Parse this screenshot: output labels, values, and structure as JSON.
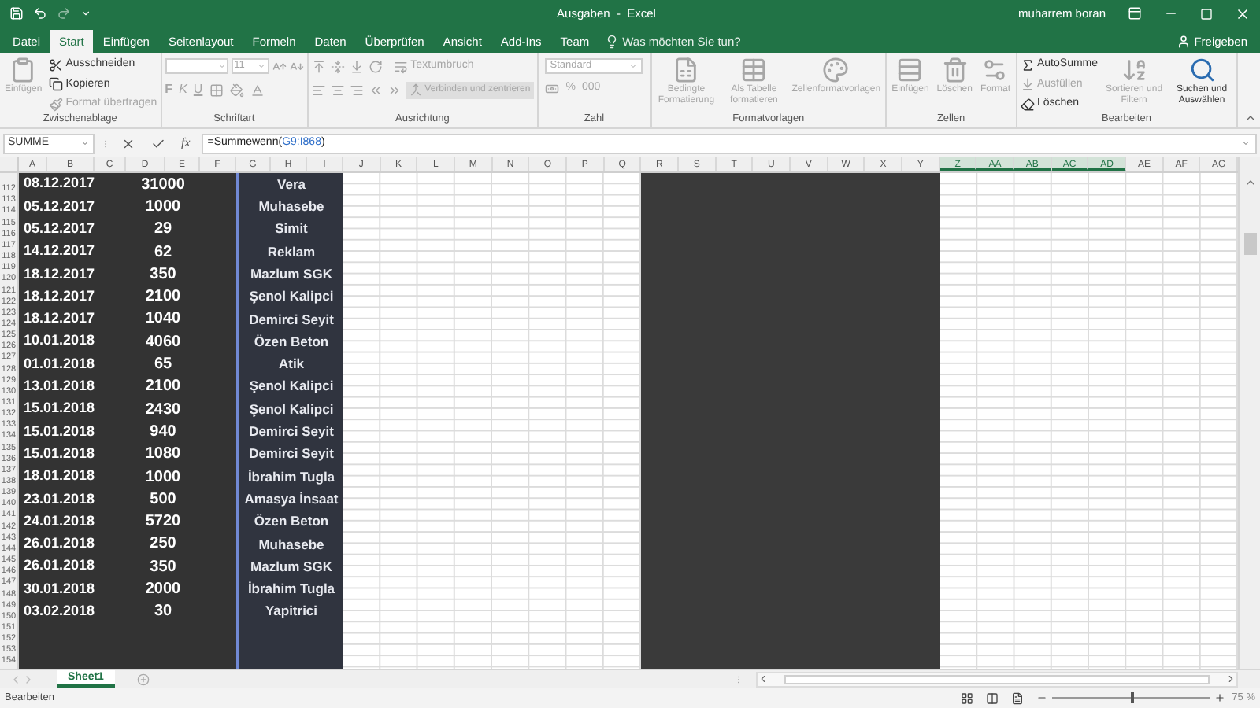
{
  "title_bar": {
    "title": "Ausgaben  -  Excel",
    "user": "muharrem boran"
  },
  "tabs": [
    {
      "label": "Datei",
      "selected": false
    },
    {
      "label": "Start",
      "selected": true
    },
    {
      "label": "Einfügen",
      "selected": false
    },
    {
      "label": "Seitenlayout",
      "selected": false
    },
    {
      "label": "Formeln",
      "selected": false
    },
    {
      "label": "Daten",
      "selected": false
    },
    {
      "label": "Überprüfen",
      "selected": false
    },
    {
      "label": "Ansicht",
      "selected": false
    },
    {
      "label": "Add-Ins",
      "selected": false
    },
    {
      "label": "Team",
      "selected": false
    }
  ],
  "tell_me": "Was möchten Sie tun?",
  "share": "Freigeben",
  "ribbon": [
    {
      "kind": "items",
      "label": "Zwischenablage",
      "items": [
        {
          "label": "Einfügen",
          "kind": "large",
          "disabled": true
        },
        {
          "label": "Ausschneiden",
          "kind": "small",
          "disabled": false
        },
        {
          "label": "Kopieren",
          "kind": "small",
          "disabled": false
        },
        {
          "label": "Format übertragen",
          "kind": "small",
          "disabled": true
        }
      ]
    },
    {
      "kind": "font",
      "label": "Schriftart",
      "font_size": "11",
      "style_buttons": [
        "F",
        "K",
        "U"
      ],
      "disabled": true
    },
    {
      "kind": "alignment",
      "label": "Ausrichtung",
      "wrap": "Textumbruch",
      "merge": "Verbinden und zentrieren",
      "disabled": true
    },
    {
      "kind": "number",
      "label": "Zahl",
      "format": "Standard",
      "number_buttons": [
        "%",
        "000"
      ],
      "disabled": true
    },
    {
      "kind": "items",
      "label": "Formatvorlagen",
      "items": [
        {
          "label": "Bedingte Formatierung",
          "kind": "large",
          "disabled": true
        },
        {
          "label": "Als Tabelle formatieren",
          "kind": "large",
          "disabled": true
        },
        {
          "label": "Zellenformatvorlagen",
          "kind": "large",
          "disabled": true
        }
      ]
    },
    {
      "kind": "items",
      "label": "Zellen",
      "items": [
        {
          "label": "Einfügen",
          "kind": "large",
          "disabled": true
        },
        {
          "label": "Löschen",
          "kind": "large",
          "disabled": true
        },
        {
          "label": "Format",
          "kind": "large",
          "disabled": true
        }
      ]
    },
    {
      "kind": "items",
      "label": "Bearbeiten",
      "items": [
        {
          "label": "AutoSumme",
          "kind": "small",
          "disabled": false
        },
        {
          "label": "Ausfüllen",
          "kind": "small",
          "disabled": true
        },
        {
          "label": "Löschen",
          "kind": "small",
          "disabled": false
        },
        {
          "label": "Sortieren und Filtern",
          "kind": "large",
          "disabled": true
        },
        {
          "label": "Suchen und Auswählen",
          "kind": "large",
          "disabled": false
        }
      ]
    }
  ],
  "formula_bar": {
    "name_box": "SUMME",
    "fx": "fx",
    "formula": [
      {
        "text": "=Summewenn(",
        "kind": "text"
      },
      {
        "text": "G9:I868",
        "kind": "ref"
      },
      {
        "text": ")",
        "kind": "text"
      }
    ]
  },
  "sheet": {
    "columns": [
      {
        "label": "A",
        "selected": false
      },
      {
        "label": "B",
        "selected": false
      },
      {
        "label": "C",
        "selected": false
      },
      {
        "label": "D",
        "selected": false
      },
      {
        "label": "E",
        "selected": false
      },
      {
        "label": "F",
        "selected": false
      },
      {
        "label": "G",
        "selected": false
      },
      {
        "label": "H",
        "selected": false
      },
      {
        "label": "I",
        "selected": false
      },
      {
        "label": "J",
        "selected": false
      },
      {
        "label": "K",
        "selected": false
      },
      {
        "label": "L",
        "selected": false
      },
      {
        "label": "M",
        "selected": false
      },
      {
        "label": "N",
        "selected": false
      },
      {
        "label": "O",
        "selected": false
      },
      {
        "label": "P",
        "selected": false
      },
      {
        "label": "Q",
        "selected": false
      },
      {
        "label": "R",
        "selected": false
      },
      {
        "label": "S",
        "selected": false
      },
      {
        "label": "T",
        "selected": false
      },
      {
        "label": "U",
        "selected": false
      },
      {
        "label": "V",
        "selected": false
      },
      {
        "label": "W",
        "selected": false
      },
      {
        "label": "X",
        "selected": false
      },
      {
        "label": "Y",
        "selected": false
      },
      {
        "label": "Z",
        "selected": true
      },
      {
        "label": "AA",
        "selected": true
      },
      {
        "label": "AB",
        "selected": true
      },
      {
        "label": "AC",
        "selected": true
      },
      {
        "label": "AD",
        "selected": true
      },
      {
        "label": "AE",
        "selected": false
      },
      {
        "label": "AF",
        "selected": false
      },
      {
        "label": "AG",
        "selected": false
      }
    ],
    "records": [
      {
        "rows": [
          "112"
        ],
        "date": "08.12.2017",
        "amount": "31000",
        "name": "Vera"
      },
      {
        "rows": [
          "113",
          "114"
        ],
        "date": "05.12.2017",
        "amount": "1000",
        "name": "Muhasebe"
      },
      {
        "rows": [
          "115",
          "116"
        ],
        "date": "05.12.2017",
        "amount": "29",
        "name": "Simit"
      },
      {
        "rows": [
          "117",
          "118"
        ],
        "date": "14.12.2017",
        "amount": "62",
        "name": "Reklam"
      },
      {
        "rows": [
          "119",
          "120"
        ],
        "date": "18.12.2017",
        "amount": "350",
        "name": "Mazlum SGK"
      },
      {
        "rows": [
          "121",
          "122"
        ],
        "date": "18.12.2017",
        "amount": "2100",
        "name": "Şenol Kalipci"
      },
      {
        "rows": [
          "123",
          "124"
        ],
        "date": "18.12.2017",
        "amount": "1040",
        "name": "Demirci Seyit"
      },
      {
        "rows": [
          "125",
          "126"
        ],
        "date": "10.01.2018",
        "amount": "4060",
        "name": "Özen Beton"
      },
      {
        "rows": [
          "127",
          "128"
        ],
        "date": "01.01.2018",
        "amount": "65",
        "name": "Atik"
      },
      {
        "rows": [
          "129",
          "130"
        ],
        "date": "13.01.2018",
        "amount": "2100",
        "name": "Şenol Kalipci"
      },
      {
        "rows": [
          "131",
          "132"
        ],
        "date": "15.01.2018",
        "amount": "2430",
        "name": "Şenol Kalipci"
      },
      {
        "rows": [
          "133",
          "134"
        ],
        "date": "15.01.2018",
        "amount": "940",
        "name": "Demirci Seyit"
      },
      {
        "rows": [
          "135",
          "136"
        ],
        "date": "15.01.2018",
        "amount": "1080",
        "name": "Demirci Seyit"
      },
      {
        "rows": [
          "137",
          "138"
        ],
        "date": "18.01.2018",
        "amount": "1000",
        "name": "İbrahim Tugla"
      },
      {
        "rows": [
          "139",
          "140"
        ],
        "date": "23.01.2018",
        "amount": "500",
        "name": "Amasya İnsaat"
      },
      {
        "rows": [
          "141",
          "142"
        ],
        "date": "24.01.2018",
        "amount": "5720",
        "name": "Özen Beton"
      },
      {
        "rows": [
          "143",
          "144"
        ],
        "date": "26.01.2018",
        "amount": "250",
        "name": "Muhasebe"
      },
      {
        "rows": [
          "145",
          "146"
        ],
        "date": "26.01.2018",
        "amount": "350",
        "name": "Mazlum SGK"
      },
      {
        "rows": [
          "147",
          "148"
        ],
        "date": "30.01.2018",
        "amount": "2000",
        "name": "İbrahim Tugla"
      },
      {
        "rows": [
          "149",
          "150"
        ],
        "date": "03.02.2018",
        "amount": "30",
        "name": "Yapitrici"
      }
    ],
    "empty_rows": [
      "151",
      "152",
      "153",
      "154"
    ]
  },
  "sheet_tabs": [
    {
      "label": "Sheet1",
      "selected": true
    }
  ],
  "status_bar": {
    "mode": "Bearbeiten",
    "zoom": {
      "level": 0.5,
      "reading": "75 %"
    }
  }
}
